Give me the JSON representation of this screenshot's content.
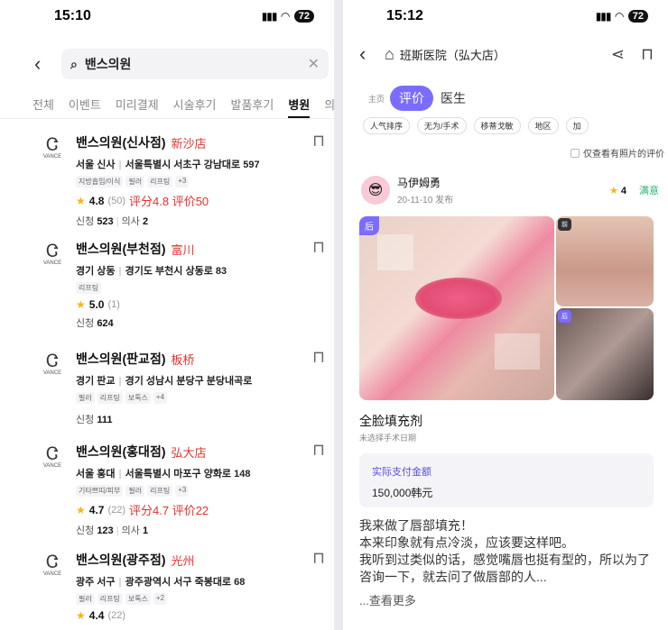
{
  "left": {
    "status": {
      "time": "15:10",
      "battery": "72"
    },
    "search": {
      "query": "밴스의원"
    },
    "tabs": [
      "전체",
      "이벤트",
      "미리결제",
      "시술후기",
      "발품후기",
      "병원",
      "의사"
    ],
    "active_tab": "병원",
    "clinics": [
      {
        "name": "밴스의원(신사점)",
        "cn": "新沙店",
        "region": "서울 신사",
        "address": "서울특별시 서초구 강남대로 597",
        "tags": [
          "지방흡입/이식",
          "필러",
          "리프팅",
          "+3"
        ],
        "rating": "4.8",
        "count": "(50)",
        "cn_rating": "评分4.8 评价50",
        "apply_label": "신청",
        "apply": "523",
        "doctor_label": "의사",
        "doctors": "2"
      },
      {
        "name": "밴스의원(부천점)",
        "cn": "富川",
        "region": "경기 상동",
        "address": "경기도 부천시 상동로 83",
        "tags": [
          "리프팅"
        ],
        "rating": "5.0",
        "count": "(1)",
        "cn_rating": "",
        "apply_label": "신청",
        "apply": "624",
        "doctor_label": "",
        "doctors": ""
      },
      {
        "name": "밴스의원(판교점)",
        "cn": "板桥",
        "region": "경기 판교",
        "address": "경기 성남시 분당구 분당내곡로",
        "tags": [
          "필러",
          "리프팅",
          "보톡스",
          "+4"
        ],
        "rating": "",
        "count": "",
        "cn_rating": "",
        "apply_label": "신청",
        "apply": "111",
        "doctor_label": "",
        "doctors": ""
      },
      {
        "name": "밴스의원(홍대점)",
        "cn": "弘大店",
        "region": "서울 홍대",
        "address": "서울특별시 마포구 양화로 148",
        "tags": [
          "기타쁘띠/피부",
          "필러",
          "리프팅",
          "+3"
        ],
        "rating": "4.7",
        "count": "(22)",
        "cn_rating": "评分4.7 评价22",
        "apply_label": "신청",
        "apply": "123",
        "doctor_label": "의사",
        "doctors": "1"
      },
      {
        "name": "밴스의원(광주점)",
        "cn": "光州",
        "region": "광주 서구",
        "address": "광주광역시 서구 죽봉대로 68",
        "tags": [
          "필러",
          "리프팅",
          "보톡스",
          "+2"
        ],
        "rating": "4.4",
        "count": "(22)",
        "cn_rating": "",
        "apply_label": "",
        "apply": "",
        "doctor_label": "",
        "doctors": ""
      }
    ]
  },
  "right": {
    "status": {
      "time": "15:12",
      "battery": "72"
    },
    "title": "班斯医院（弘大店）",
    "tabs": {
      "home": "主页",
      "reviews": "评价",
      "doctors": "医生"
    },
    "filters": [
      "人气排序",
      "无为/手术",
      "移蒂戈敏",
      "地区",
      "加"
    ],
    "photo_only": "仅查看有照片的评价",
    "review": {
      "user": "马伊姆勇",
      "date": "20-11-10 发布",
      "score": "4",
      "satisfaction": "满意",
      "tag_after": "后",
      "tag_before": "前",
      "procedure": "全脸填充剂",
      "procedure_sub": "未选择手术日期",
      "pay_label": "实际支付金额",
      "pay_value": "150,000韩元",
      "text": "我来做了唇部填充！\n本来印象就有点冷淡，应该要这样吧。\n我听到过类似的话，感觉嘴唇也挺有型的，所以为了咨询一下，就去问了做唇部的人...",
      "more": "...查看更多"
    }
  },
  "colors": {
    "accent": "#7b6cff",
    "red": "#e5312d",
    "star": "#f3b51a",
    "satisfied": "#2bb673"
  }
}
